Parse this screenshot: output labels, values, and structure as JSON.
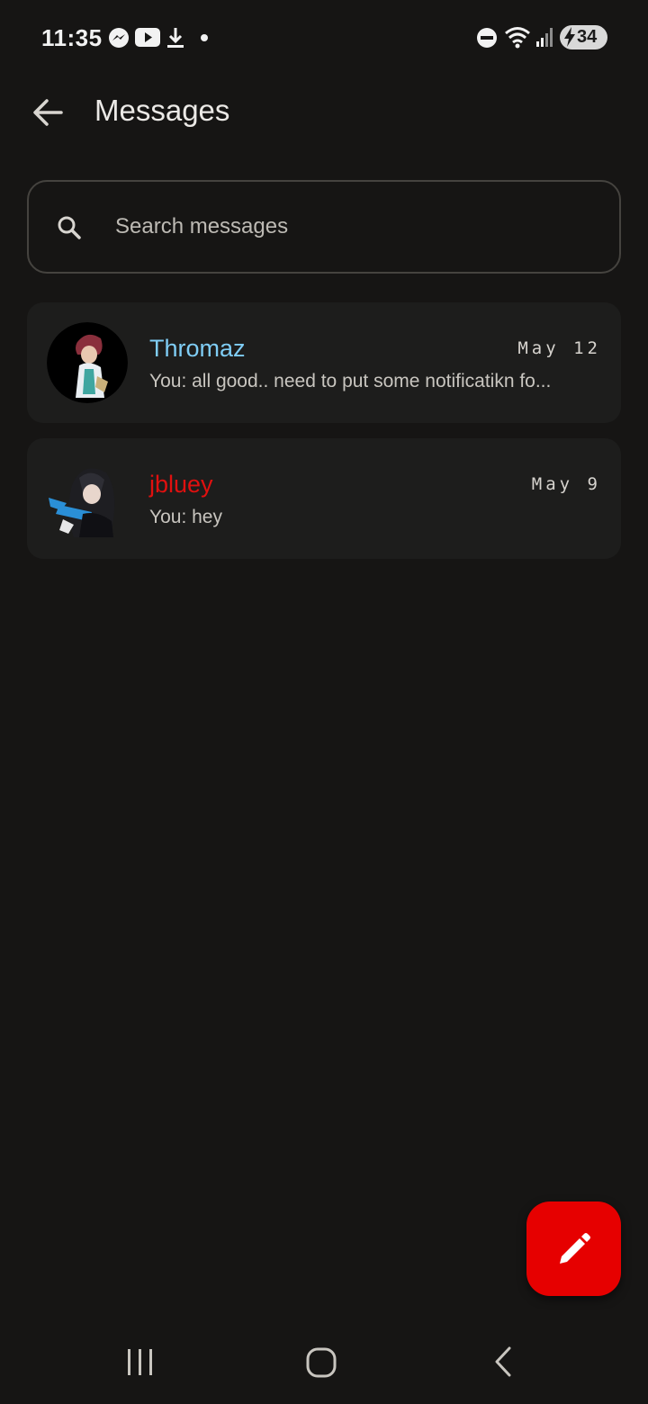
{
  "status_bar": {
    "time": "11:35",
    "battery": "34",
    "icons": [
      "messenger-icon",
      "youtube-icon",
      "download-icon",
      "dot-icon",
      "do-not-disturb-icon",
      "wifi-icon",
      "signal-icon",
      "battery-charging-icon"
    ]
  },
  "header": {
    "title": "Messages"
  },
  "search": {
    "placeholder": "Search messages",
    "value": ""
  },
  "conversations": [
    {
      "name": "Thromaz",
      "name_color": "#7fcdf5",
      "date": "May 12",
      "preview": "You: all good.. need to put some notificatikn fo..."
    },
    {
      "name": "jbluey",
      "name_color": "#e0100f",
      "date": "May 9",
      "preview": "You: hey"
    }
  ],
  "fab": {
    "icon": "pencil-icon",
    "color": "#e60000"
  },
  "nav": {
    "icons": [
      "recent-apps-icon",
      "home-icon",
      "back-icon"
    ]
  }
}
